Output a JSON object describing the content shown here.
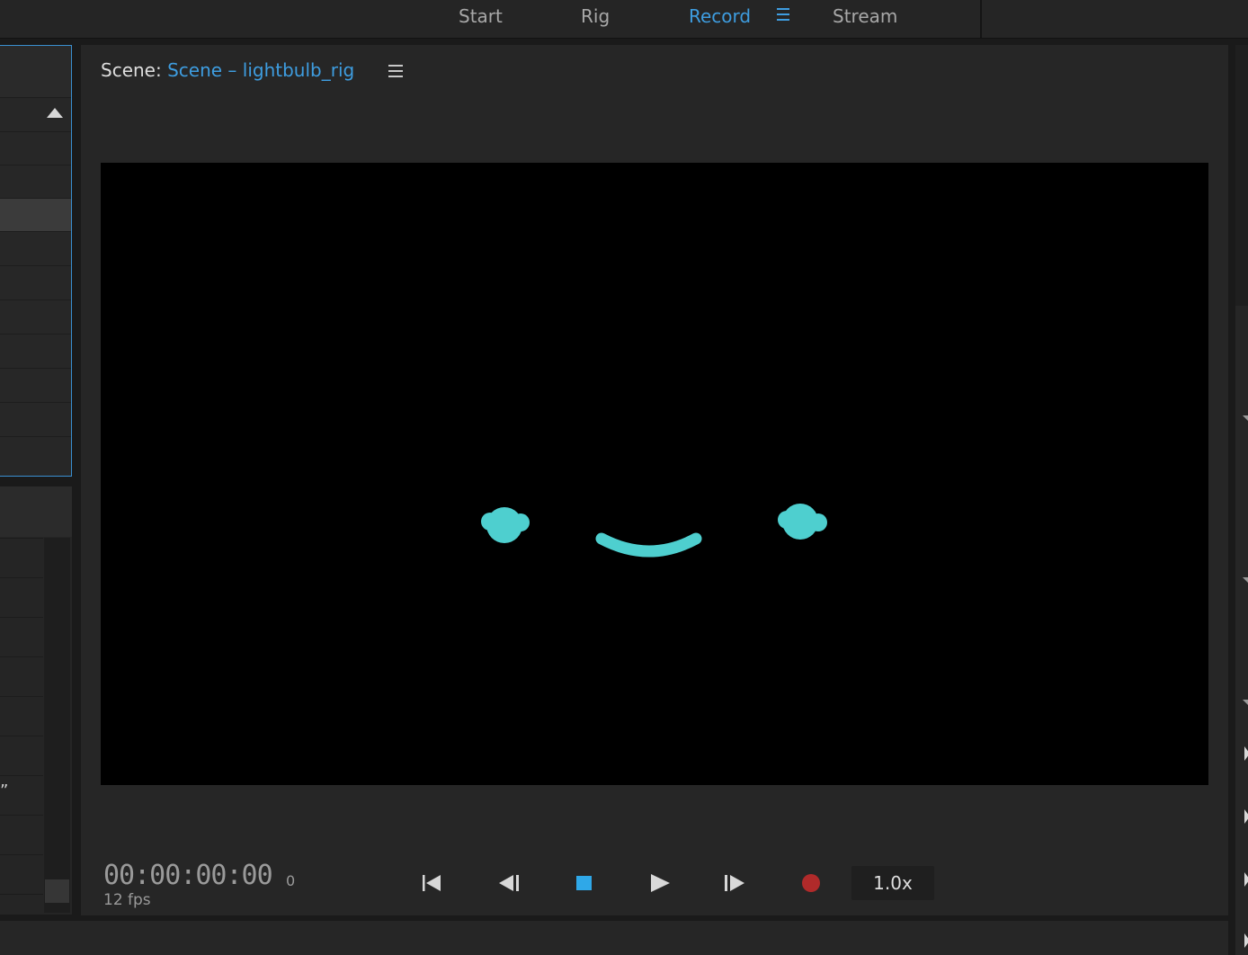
{
  "workspace_tabs": [
    {
      "label": "Start",
      "active": false
    },
    {
      "label": "Rig",
      "active": false
    },
    {
      "label": "Record",
      "active": true
    },
    {
      "label": "Stream",
      "active": false
    }
  ],
  "scene": {
    "label": "Scene:",
    "name": "Scene – lightbulb_rig"
  },
  "playback": {
    "timecode": "00:00:00:00",
    "frame": "0",
    "fps": "12 fps",
    "speed": "1.0x"
  },
  "left_panel": {
    "quote_mark": "”"
  },
  "colors": {
    "accent": "#3e9de0",
    "character": "#4ecfcf",
    "record": "#b02a2a",
    "stage": "#000000"
  },
  "icons": [
    "workspace-menu-icon",
    "scene-menu-icon",
    "go-to-start-icon",
    "step-back-icon",
    "stop-icon",
    "play-icon",
    "step-forward-icon",
    "record-icon",
    "collapse-triangle-icon"
  ]
}
